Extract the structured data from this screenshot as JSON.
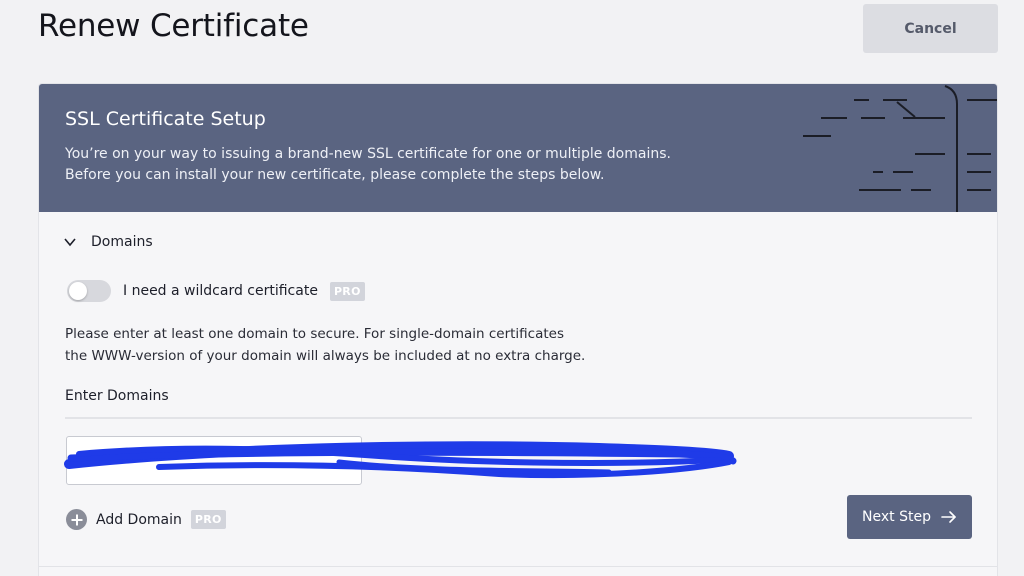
{
  "page": {
    "title": "Renew Certificate",
    "cancel_label": "Cancel"
  },
  "header": {
    "title": "SSL Certificate Setup",
    "description_line1": "You’re on your way to issuing a brand-new SSL certificate for one or multiple domains.",
    "description_line2": "Before you can install your new certificate, please complete the steps below."
  },
  "domains_section": {
    "title": "Domains",
    "expanded": true,
    "wildcard": {
      "label": "I need a wildcard certificate",
      "badge": "PRO",
      "enabled": false
    },
    "info_line1": "Please enter at least one domain to secure. For single-domain certificates",
    "info_line2": "the WWW-version of your domain will always be included at no extra charge.",
    "enter_label": "Enter Domains",
    "domain_input_value": "",
    "add_domain_label": "Add Domain",
    "add_domain_badge": "PRO",
    "next_step_label": "Next Step"
  },
  "icons": {
    "section_toggle": "chevron-down-icon",
    "add": "plus-circle-icon",
    "next": "arrow-right-icon"
  },
  "colors": {
    "header_bg": "#5a6481",
    "primary_button": "#5a6481",
    "cancel_button": "#dcdde2",
    "page_bg": "#f2f2f4",
    "redaction": "#1f3be8"
  }
}
